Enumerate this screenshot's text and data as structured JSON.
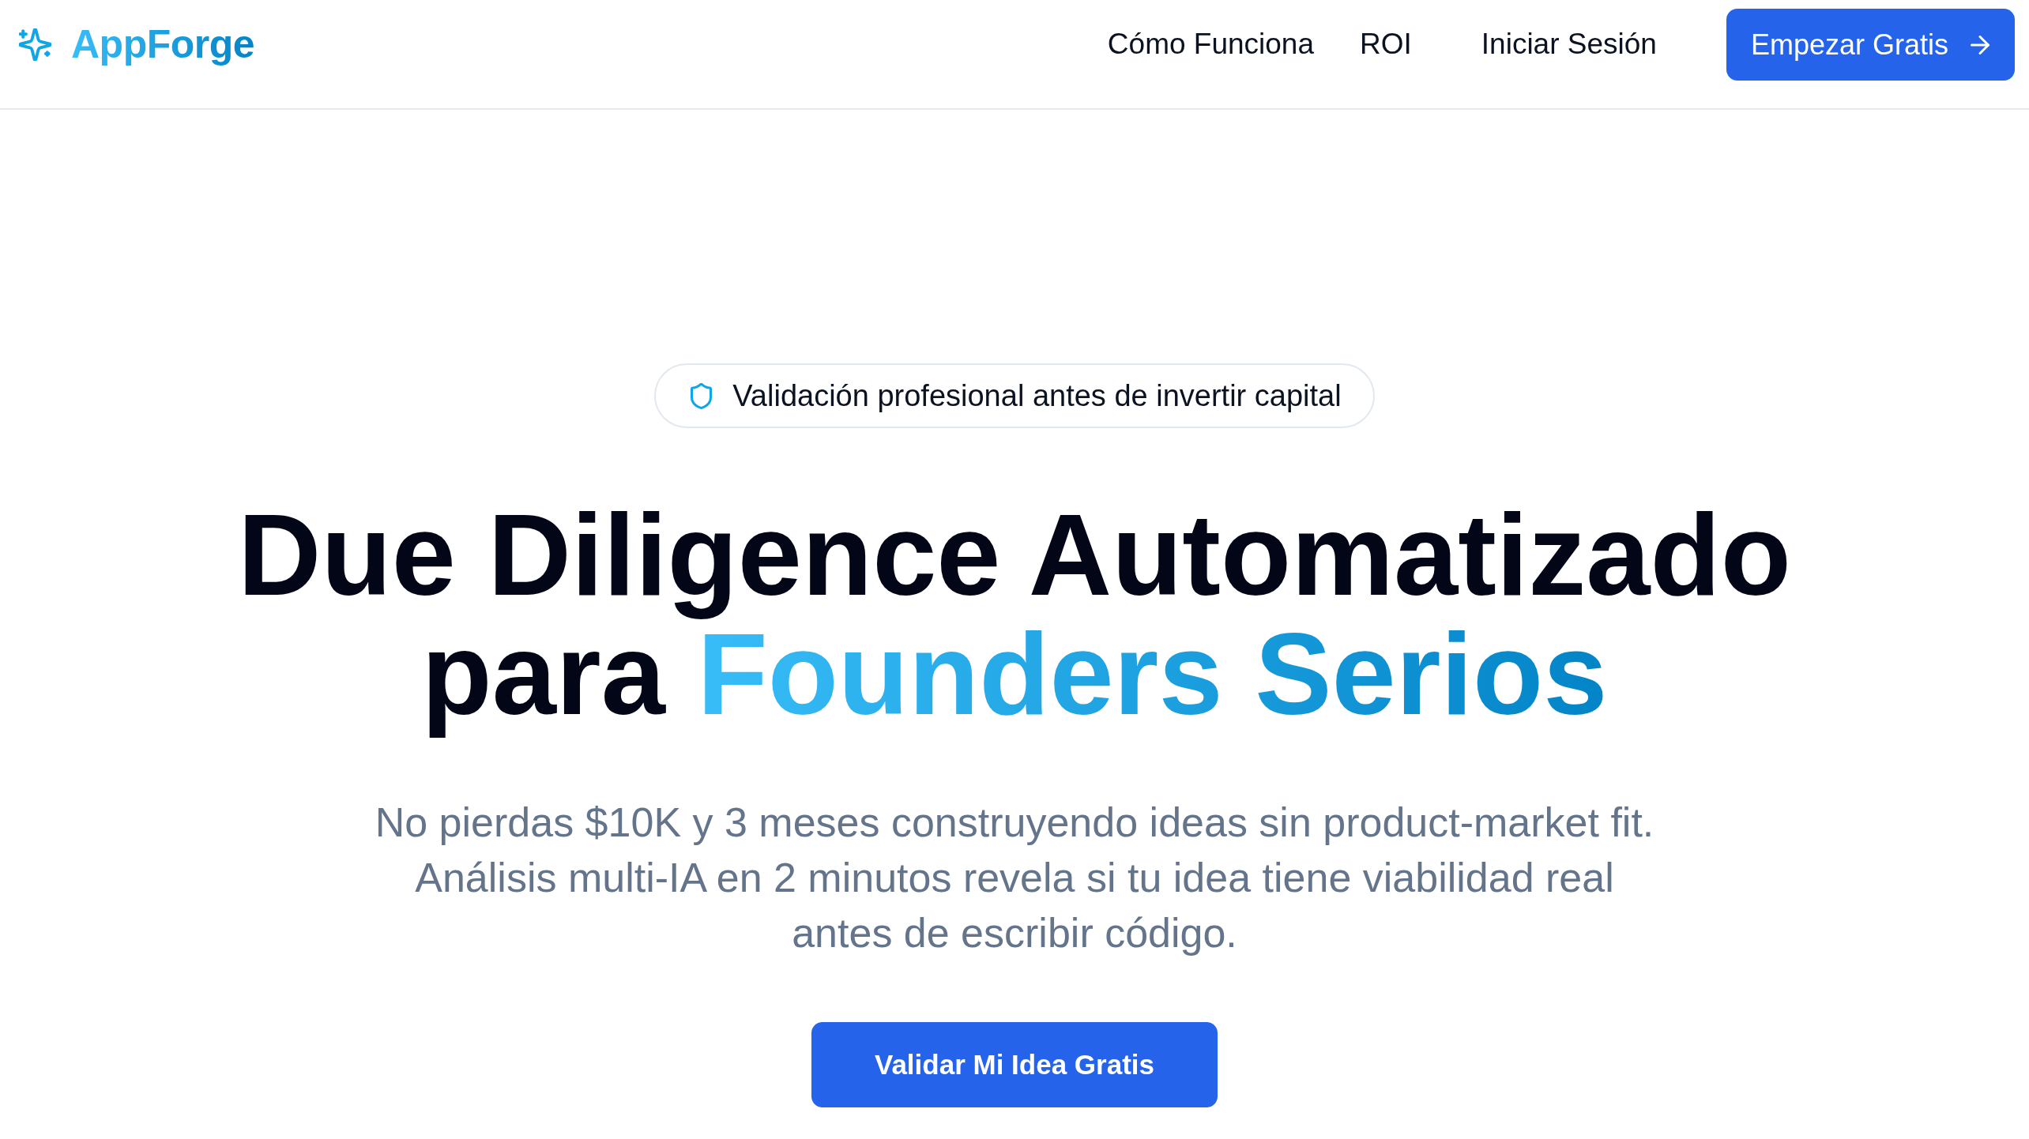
{
  "header": {
    "logo": "AppForge",
    "nav_links": [
      "Cómo Funciona",
      "ROI"
    ],
    "login_link": "Iniciar Sesión",
    "cta_button": "Empezar Gratis"
  },
  "hero": {
    "badge": "Validación profesional antes de invertir capital",
    "headline": {
      "text": "Due Diligence Automatizado para",
      "highlight": "Founders Serios"
    },
    "subtitle": "No pierdas $10K y 3 meses construyendo ideas sin product-market fit. Análisis multi-IA en 2 minutos revela si tu idea tiene viabilidad real antes de escribir código.",
    "cta_button": "Validar Mi Idea Gratis"
  }
}
